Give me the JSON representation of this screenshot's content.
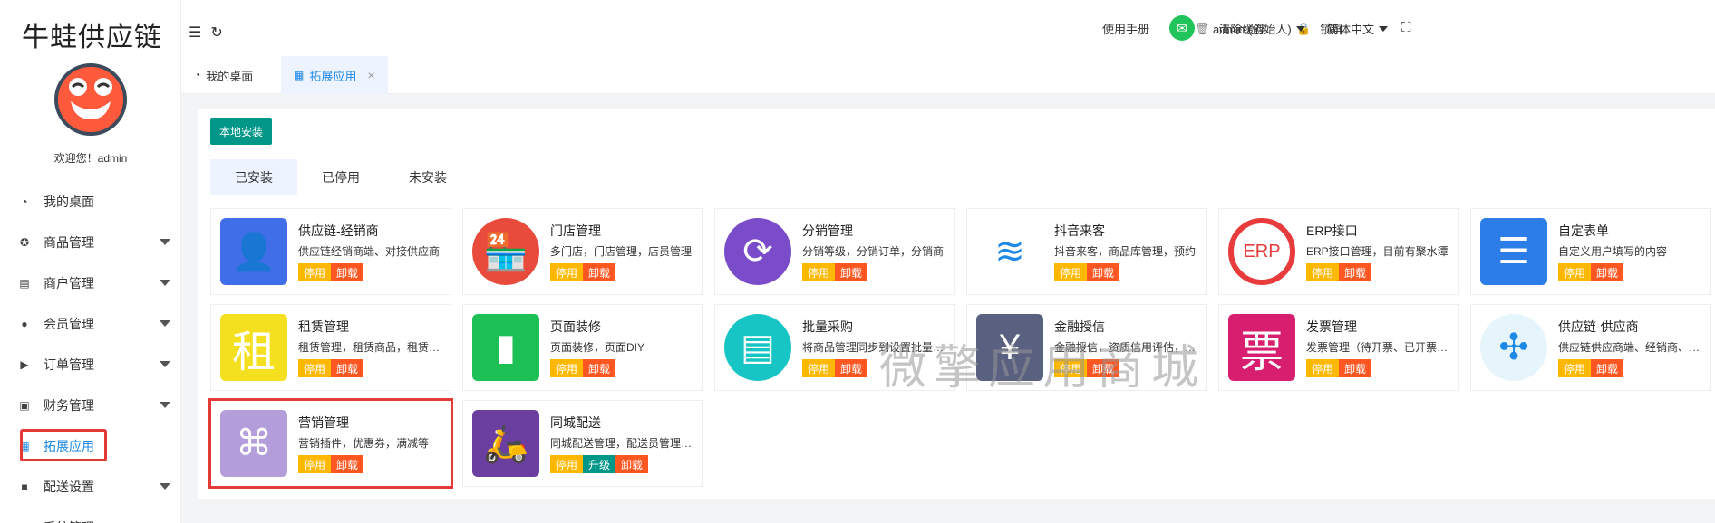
{
  "app": {
    "title": "牛蛙供应链",
    "welcome": "欢迎您！admin"
  },
  "sidebar": {
    "items": [
      {
        "label": "我的桌面",
        "icon": "dashboard-icon",
        "glyph": "◔",
        "caret": false
      },
      {
        "label": "商品管理",
        "icon": "product-icon",
        "glyph": "✪",
        "caret": true
      },
      {
        "label": "商户管理",
        "icon": "merchant-icon",
        "glyph": "▤",
        "caret": true
      },
      {
        "label": "会员管理",
        "icon": "user-icon",
        "glyph": "●",
        "caret": true
      },
      {
        "label": "订单管理",
        "icon": "cart-icon",
        "glyph": "▶",
        "caret": true
      },
      {
        "label": "财务管理",
        "icon": "money-icon",
        "glyph": "▣",
        "caret": true
      },
      {
        "label": "拓展应用",
        "icon": "grid-icon",
        "glyph": "▦",
        "caret": false,
        "active": true
      },
      {
        "label": "配送设置",
        "icon": "truck-icon",
        "glyph": "■",
        "caret": true
      },
      {
        "label": "系统管理",
        "icon": "settings-icon",
        "glyph": "▲",
        "caret": false
      }
    ]
  },
  "header": {
    "manual": "使用手册",
    "clear_cache": "清除缓存",
    "lock": "锁屏",
    "user": "admin (创始人)",
    "language": "简体中文"
  },
  "tabs": [
    {
      "label": "我的桌面"
    },
    {
      "label": "拓展应用",
      "close": "×"
    }
  ],
  "toolbar": {
    "local_install": "本地安装"
  },
  "subtabs": [
    {
      "label": "已安装"
    },
    {
      "label": "已停用"
    },
    {
      "label": "未安装"
    }
  ],
  "colors": {
    "accent": "#1e88e5",
    "teal": "#009688",
    "stop": "#ffb800",
    "unload": "#ff5722"
  },
  "apps": [
    {
      "title": "供应链-经销商",
      "desc": "供应链经销商端、对接供应商",
      "icon": "supplier-dealer-icon",
      "bg": "#3f6ee8",
      "glyph": "👤",
      "buttons": [
        "停用",
        "卸载"
      ]
    },
    {
      "title": "门店管理",
      "desc": "多门店，门店管理，店员管理",
      "icon": "store-icon",
      "bg": "#e84b3c",
      "glyph": "🏪",
      "round": true,
      "buttons": [
        "停用",
        "卸载"
      ]
    },
    {
      "title": "分销管理",
      "desc": "分销等级，分销订单，分销商",
      "icon": "distribution-icon",
      "bg": "#7b4cc9",
      "glyph": "⟳",
      "round": true,
      "buttons": [
        "停用",
        "卸载"
      ]
    },
    {
      "title": "抖音来客",
      "desc": "抖音来客，商品库管理，预约",
      "icon": "douyin-icon",
      "bg": "#ffffff",
      "glyph": "≋",
      "buttons": [
        "停用",
        "卸载"
      ]
    },
    {
      "title": "ERP接口",
      "desc": "ERP接口管理，目前有聚水潭",
      "icon": "erp-icon",
      "bg": "#ffffff",
      "glyph": "ERP",
      "buttons": [
        "停用",
        "卸载"
      ]
    },
    {
      "title": "自定表单",
      "desc": "自定义用户填写的内容",
      "icon": "form-icon",
      "bg": "#2d7de8",
      "glyph": "☰",
      "buttons": [
        "停用",
        "卸载"
      ]
    },
    {
      "title": "租赁管理",
      "desc": "租赁管理，租赁商品，租赁订单",
      "icon": "lease-icon",
      "bg": "#f5e020",
      "glyph": "租",
      "buttons": [
        "停用",
        "卸载"
      ]
    },
    {
      "title": "页面装修",
      "desc": "页面装修，页面DIY",
      "icon": "paint-roller-icon",
      "bg": "#1dc054",
      "glyph": "▮",
      "buttons": [
        "停用",
        "卸载"
      ]
    },
    {
      "title": "批量采购",
      "desc": "将商品管理同步到设置批量采购",
      "icon": "purchase-icon",
      "bg": "#18c5c5",
      "glyph": "▤",
      "round": true,
      "buttons": [
        "停用",
        "卸载"
      ]
    },
    {
      "title": "金融授信",
      "desc": "金融授信，资质信用评估，授信",
      "icon": "credit-icon",
      "bg": "#5a6080",
      "glyph": "¥",
      "buttons": [
        "停用",
        "卸载"
      ]
    },
    {
      "title": "发票管理",
      "desc": "发票管理（待开票、已开票、作废）",
      "icon": "invoice-icon",
      "bg": "#d81f6f",
      "glyph": "票",
      "buttons": [
        "停用",
        "卸载"
      ]
    },
    {
      "title": "供应链-供应商",
      "desc": "供应链供应商端、经销商、采购",
      "icon": "supplier-icon",
      "bg": "#e6f4fb",
      "glyph": "✣",
      "round": true,
      "buttons": [
        "停用",
        "卸载"
      ]
    },
    {
      "title": "营销管理",
      "desc": "营销插件，优惠券，满减等",
      "icon": "marketing-icon",
      "bg": "#b39ddb",
      "glyph": "⌘",
      "buttons": [
        "停用",
        "卸载"
      ],
      "highlight": true
    },
    {
      "title": "同城配送",
      "desc": "同城配送管理，配送员管理，订单",
      "icon": "delivery-icon",
      "bg": "#6a3fa0",
      "glyph": "🛵",
      "buttons": [
        "停用",
        "升级",
        "卸载"
      ]
    }
  ],
  "watermark": "微擎应用商城"
}
